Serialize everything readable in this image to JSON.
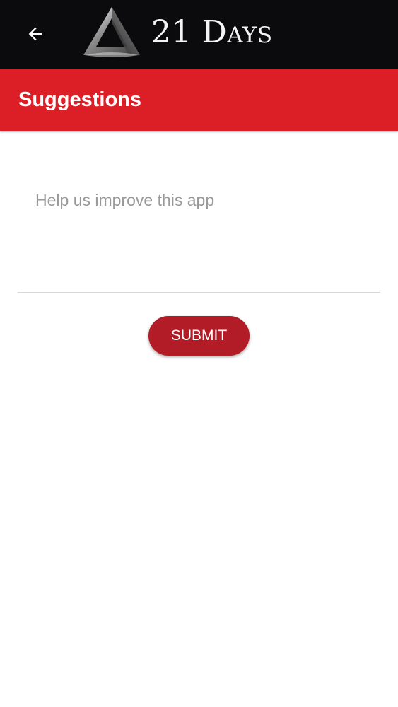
{
  "app_header": {
    "brand_title": "21 Days",
    "back_icon": "arrow-left-icon",
    "logo_icon": "triangle-logo-icon",
    "background_color": "#0b0b0d"
  },
  "toolbar": {
    "title": "Suggestions",
    "background_color": "#dc1f26"
  },
  "form": {
    "suggestion_placeholder": "Help us improve this app",
    "suggestion_value": "",
    "submit_label": "SUBMIT",
    "submit_color": "#b11c27"
  }
}
